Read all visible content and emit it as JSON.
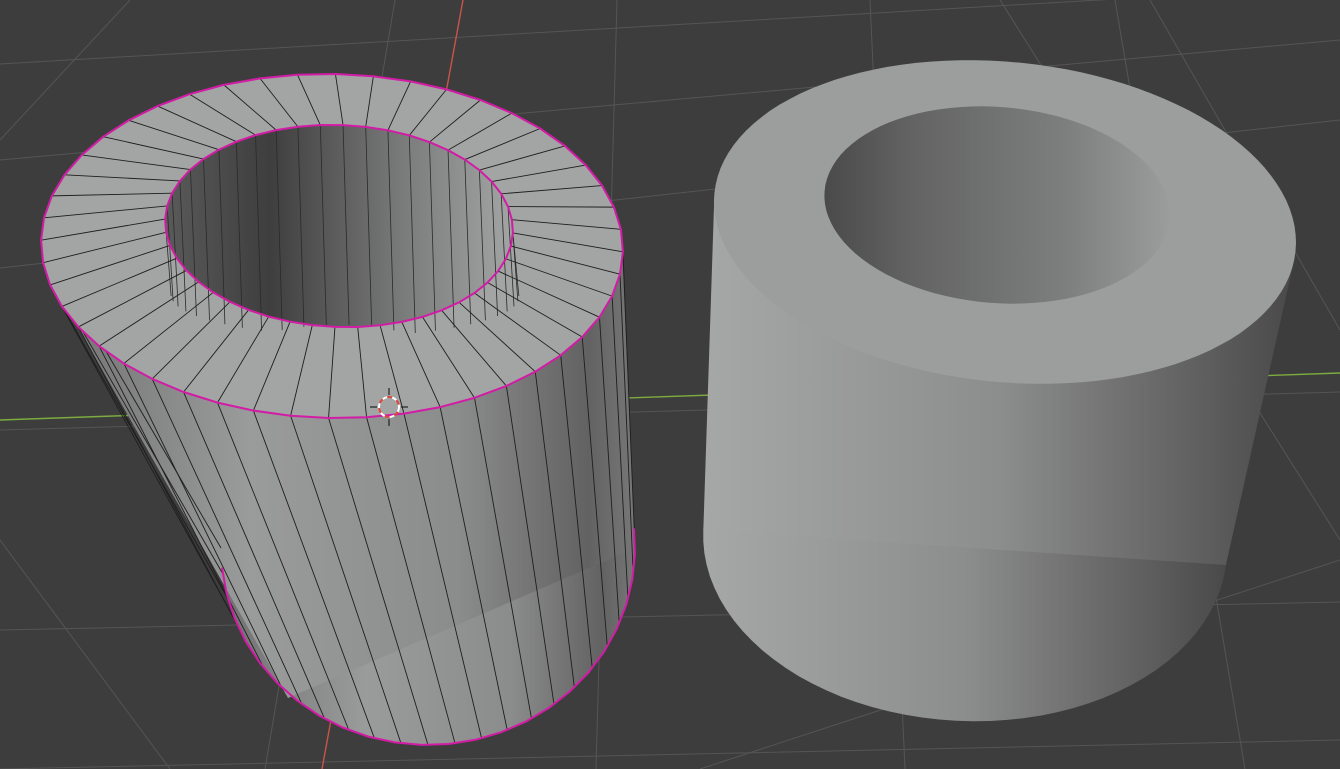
{
  "viewport": {
    "background": "#3d3d3d",
    "grid_line_color": "#555555",
    "axis_x_color": "#7cab3f",
    "axis_y_color": "#c9544a"
  },
  "objects": [
    {
      "id": "tube-edit-mode",
      "display": "wireframe-overlay",
      "selected": true,
      "selection_color": "#d21ca6",
      "segments": 48
    },
    {
      "id": "tube-object-mode",
      "display": "smooth-shaded",
      "selected": false
    }
  ],
  "cursor": {
    "icon": "3d-cursor-icon",
    "ring_color_a": "#ffffff",
    "ring_color_b": "#e0463c"
  }
}
